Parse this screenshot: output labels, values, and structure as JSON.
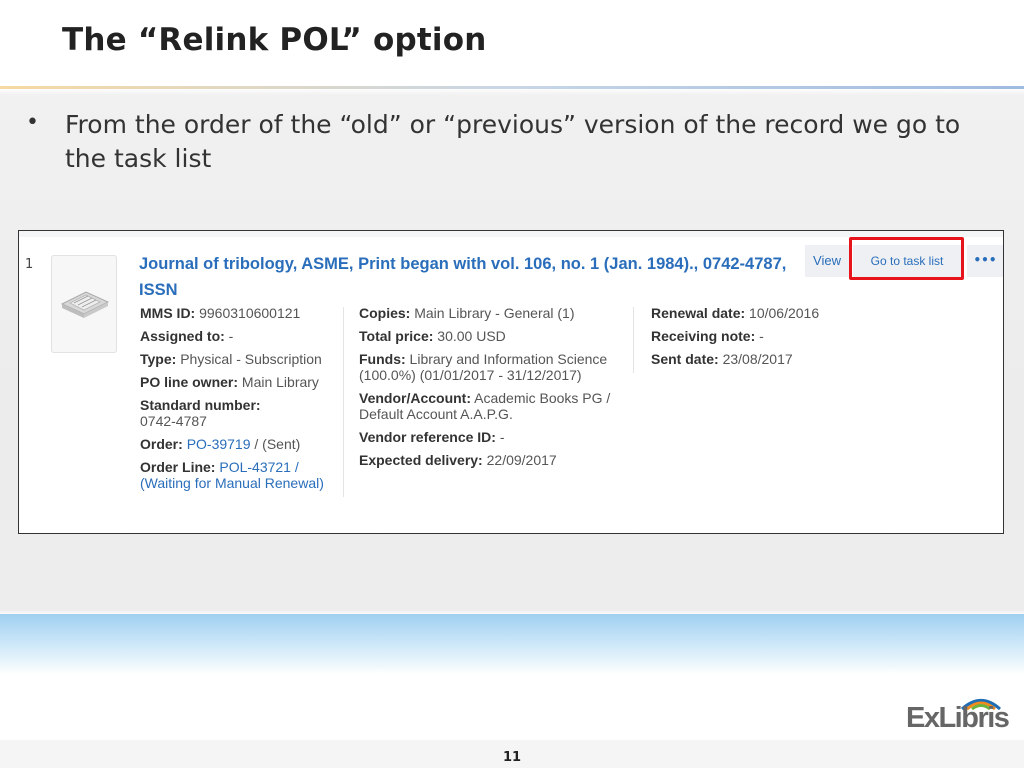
{
  "slide": {
    "title": "The “Relink POL” option",
    "bullet": "From the order of the “old” or “previous” version of the record we go to the task list",
    "page_number": "11",
    "logo_text": "ExLibris"
  },
  "record": {
    "row_number": "1",
    "title": "Journal of tribology, ASME, Print began with vol. 106, no. 1 (Jan. 1984)., 0742-4787, ISSN",
    "actions": {
      "view": "View",
      "go_to_task_list": "Go to task list",
      "more": "•••"
    },
    "col1": {
      "mms_label": "MMS ID:",
      "mms_value": " 9960310600121",
      "assigned_label": "Assigned to:",
      "assigned_value": " -",
      "type_label": "Type:",
      "type_value": " Physical - Subscription",
      "owner_label": "PO line owner:",
      "owner_value": " Main Library",
      "std_label": "Standard number:",
      "std_value": "0742-4787",
      "order_label": "Order:",
      "order_link": "PO-39719",
      "order_status": " / (Sent)",
      "line_label": "Order Line:",
      "line_link": "POL-43721 / (Waiting for Manual Renewal)"
    },
    "col2": {
      "copies_label": "Copies:",
      "copies_value": " Main Library - General (1)",
      "price_label": "Total price:",
      "price_value": " 30.00 USD",
      "funds_label": "Funds:",
      "funds_value": " Library and Information Science (100.0%) (01/01/2017 - 31/12/2017)",
      "vendor_label": "Vendor/Account:",
      "vendor_value": " Academic Books PG / Default Account A.A.P.G.",
      "vref_label": "Vendor reference ID:",
      "vref_value": " -",
      "delivery_label": "Expected delivery:",
      "delivery_value": " 22/09/2017"
    },
    "col3": {
      "renewal_label": "Renewal date:",
      "renewal_value": " 10/06/2016",
      "receiving_label": "Receiving note:",
      "receiving_value": " -",
      "sent_label": "Sent date:",
      "sent_value": " 23/08/2017"
    }
  },
  "colors": {
    "link": "#2a6ebb",
    "highlight": "#e8141b"
  }
}
